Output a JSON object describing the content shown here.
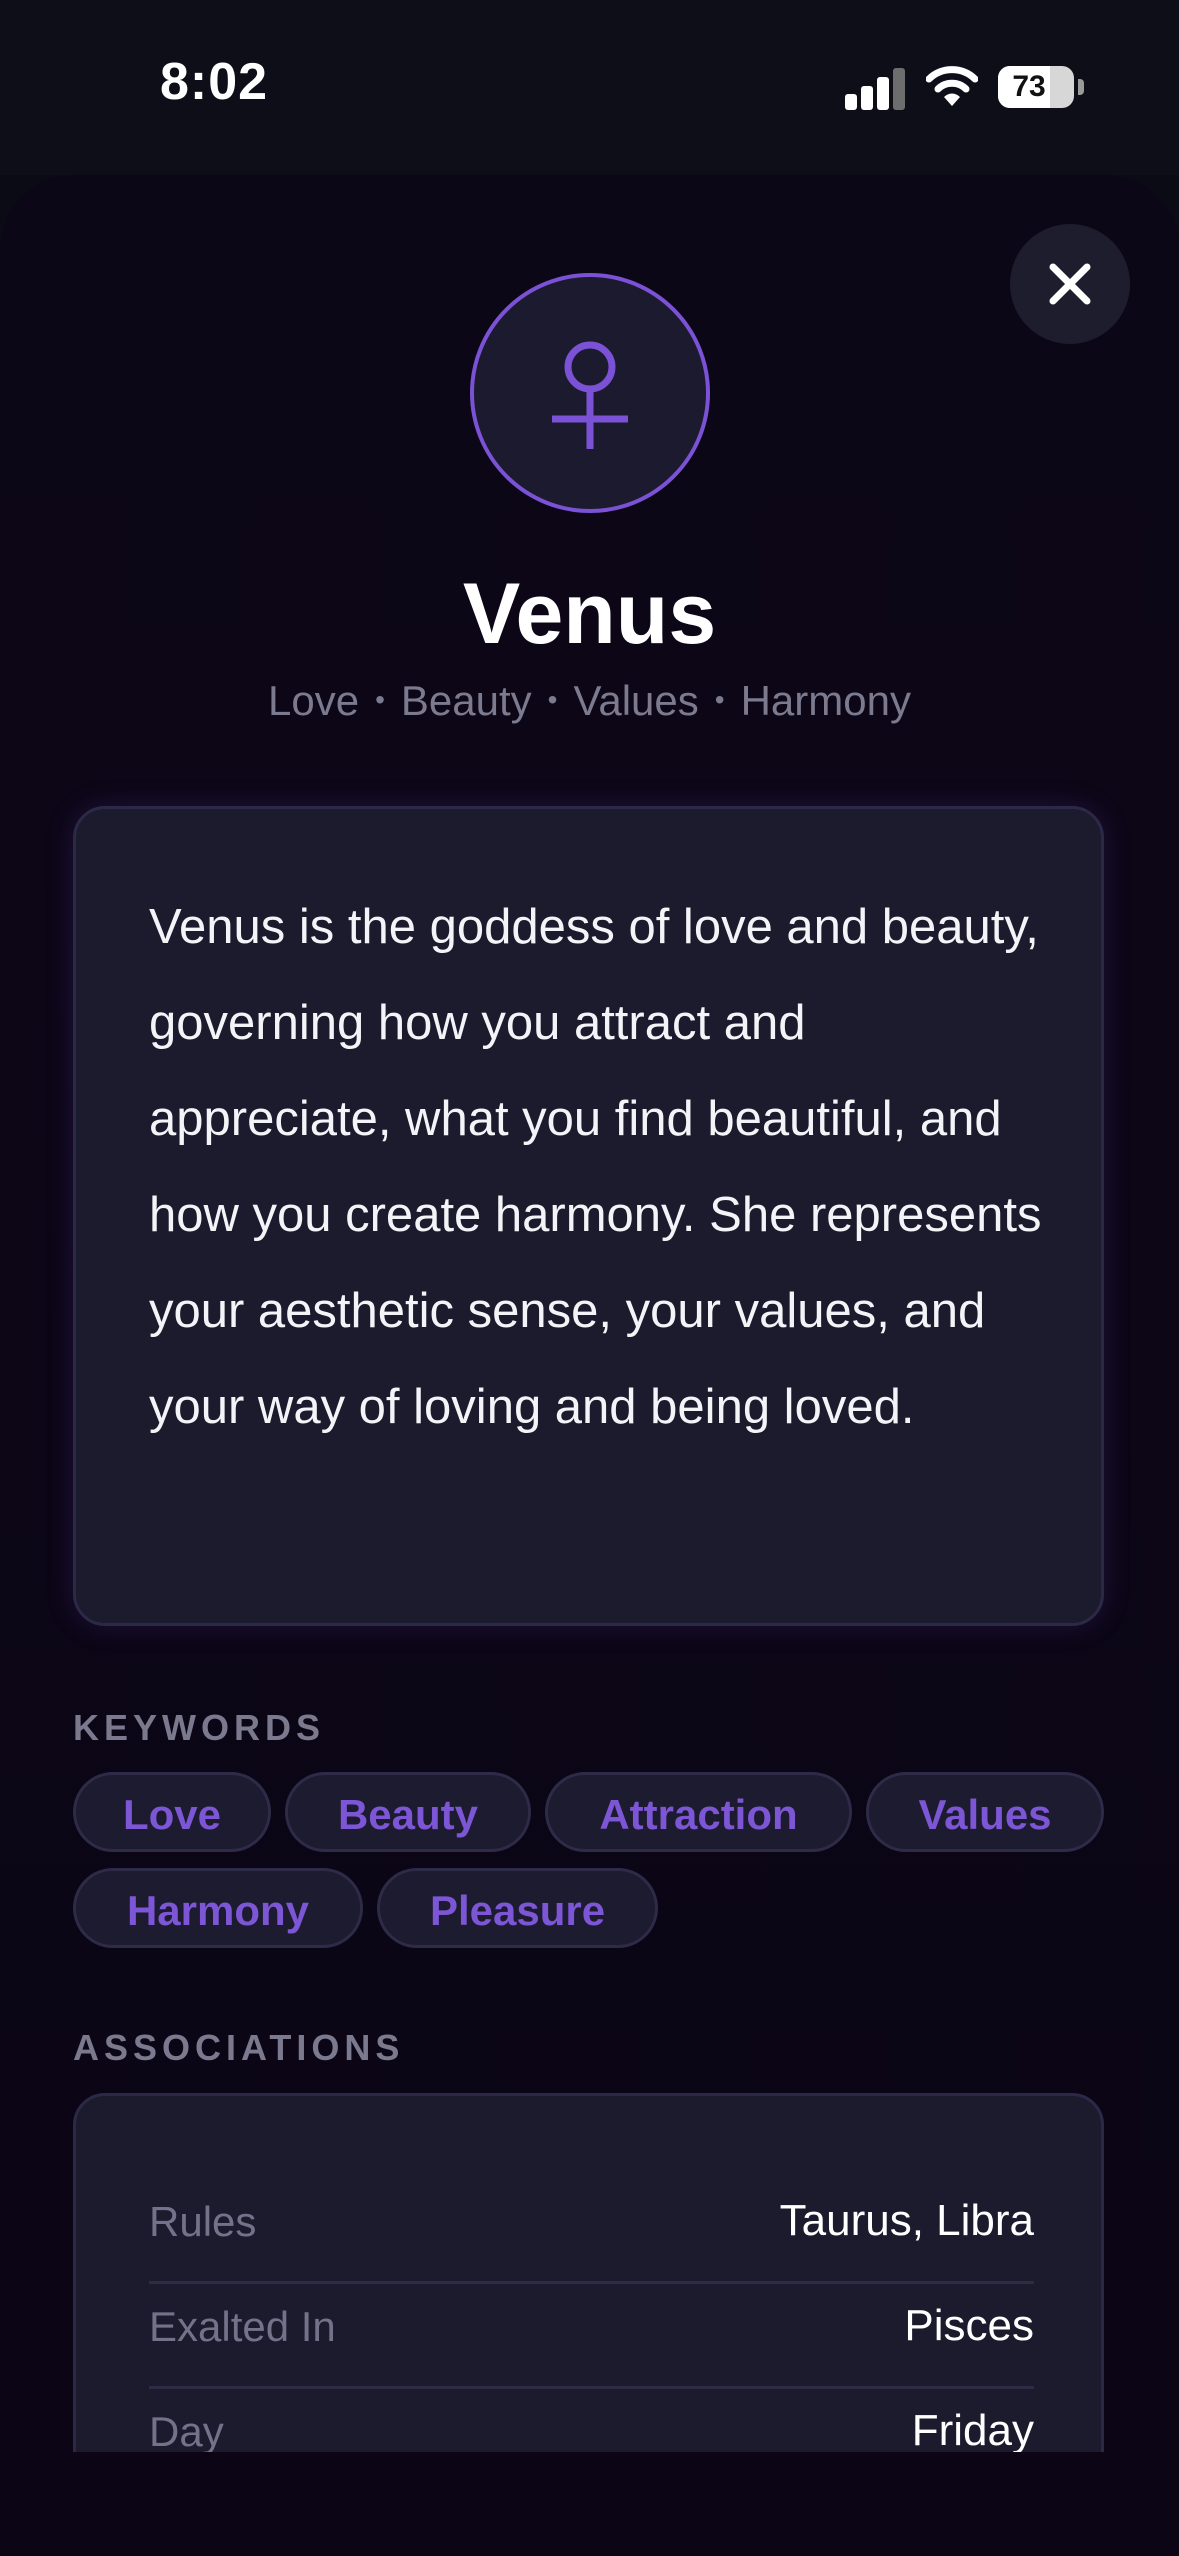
{
  "status_bar": {
    "time": "8:02",
    "battery": "73",
    "icons": [
      "signal-icon",
      "wifi-icon",
      "battery-icon"
    ]
  },
  "close_button": {
    "icon": "close-icon"
  },
  "planet": {
    "symbol_icon": "venus-symbol-icon",
    "name": "Venus",
    "subtitle_parts": [
      "Love",
      "Beauty",
      "Values",
      "Harmony"
    ],
    "description": "Venus is the goddess of love and beauty, governing how you attract and appreciate, what you find beautiful, and how you create harmony. She represents your aesthetic sense, your values, and your way of loving and being loved."
  },
  "keywords": {
    "label": "KEYWORDS",
    "items": [
      "Love",
      "Beauty",
      "Attraction",
      "Values",
      "Harmony",
      "Pleasure"
    ]
  },
  "associations": {
    "label": "ASSOCIATIONS",
    "rows": [
      {
        "label": "Rules",
        "value": "Taurus, Libra"
      },
      {
        "label": "Exalted In",
        "value": "Pisces"
      },
      {
        "label": "Day",
        "value": "Friday"
      }
    ]
  },
  "colors": {
    "accent": "#7b52d6",
    "card": "#1b1b2d",
    "background": "#0c0717",
    "muted_text": "#7c7a8f"
  }
}
